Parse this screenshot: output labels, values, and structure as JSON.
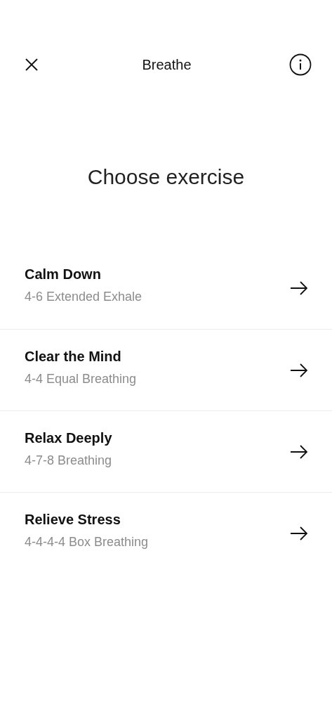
{
  "header": {
    "title": "Breathe"
  },
  "heading": "Choose exercise",
  "exercises": [
    {
      "title": "Calm Down",
      "subtitle": "4-6 Extended Exhale"
    },
    {
      "title": "Clear the Mind",
      "subtitle": "4-4 Equal Breathing"
    },
    {
      "title": "Relax Deeply",
      "subtitle": "4-7-8 Breathing"
    },
    {
      "title": "Relieve Stress",
      "subtitle": "4-4-4-4 Box Breathing"
    }
  ]
}
